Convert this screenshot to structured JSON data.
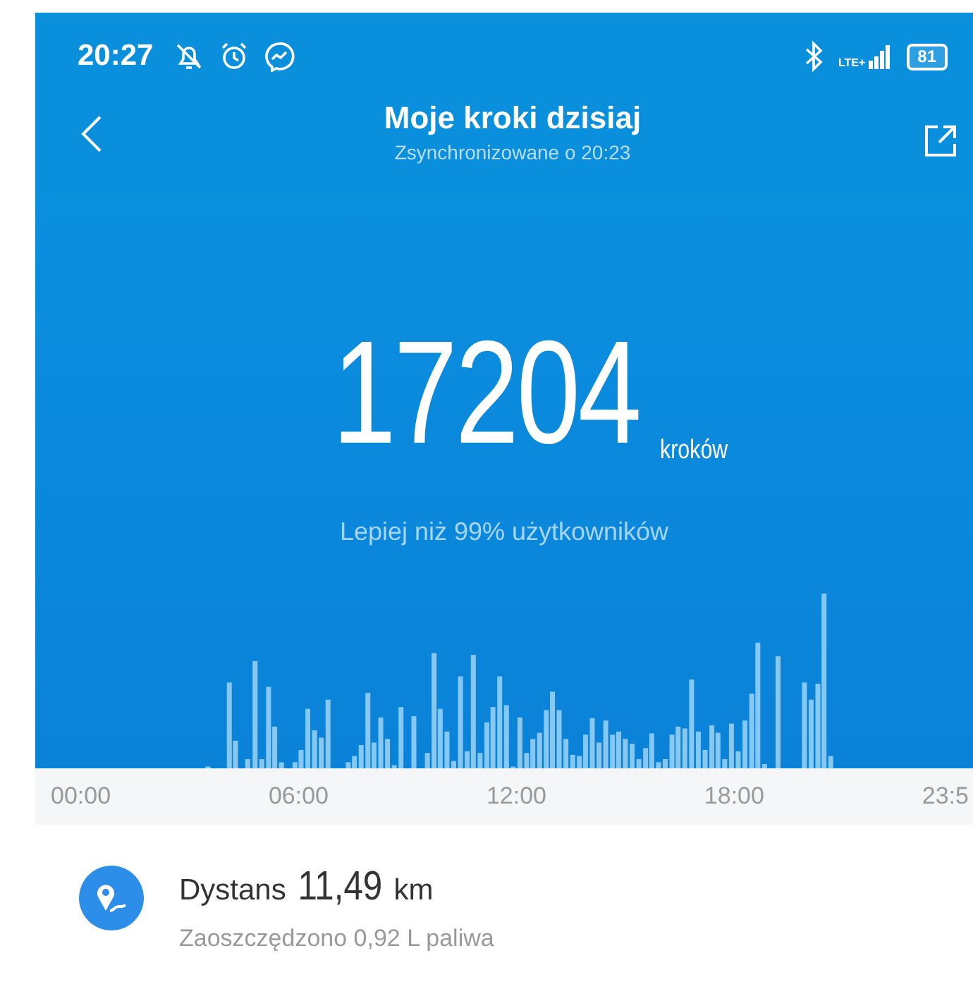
{
  "status_bar": {
    "time": "20:27",
    "network": "LTE+",
    "battery": "81"
  },
  "header": {
    "title": "Moje kroki dzisiaj",
    "subtitle": "Zsynchronizowane o 20:23"
  },
  "steps": {
    "count": "17204",
    "unit": "kroków",
    "comparison": "Lepiej niż 99% użytkowników"
  },
  "chart": {
    "x_labels": [
      "00:00",
      "06:00",
      "12:00",
      "18:00",
      "23:5"
    ]
  },
  "distance": {
    "label": "Dystans",
    "value": "11,49",
    "unit": "km",
    "savings": "Zaoszczędzono 0,92 L paliwa"
  }
}
